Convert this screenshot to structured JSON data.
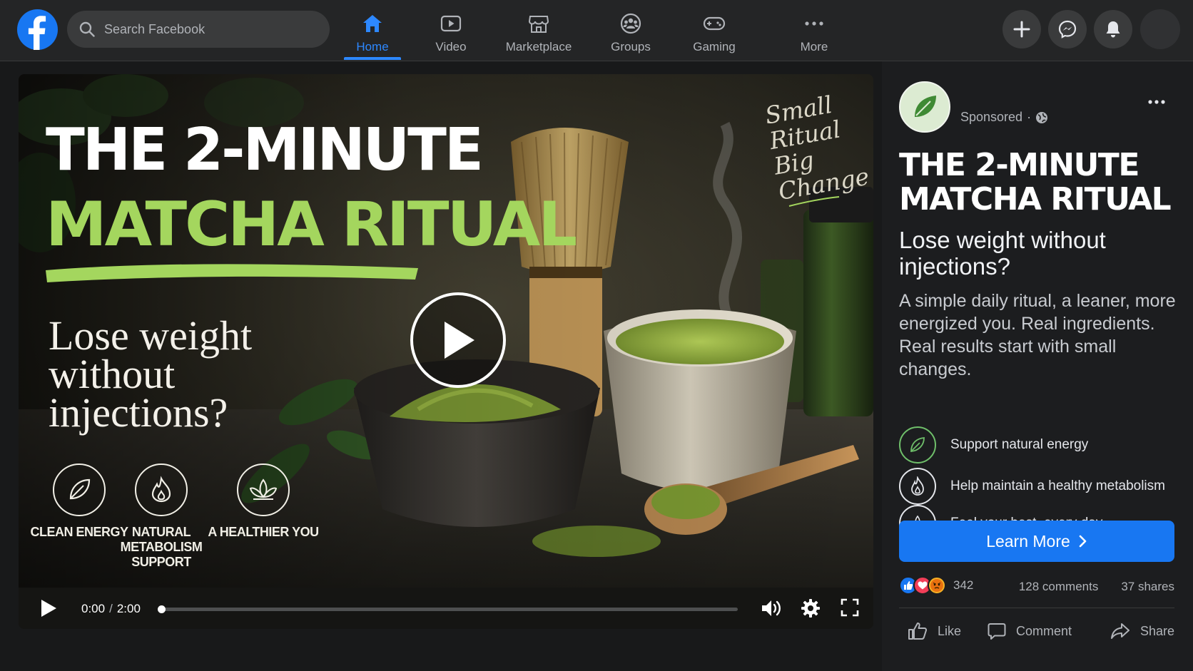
{
  "nav": {
    "search_placeholder": "Search Facebook",
    "tabs": [
      {
        "label": "Home",
        "icon": "home-icon",
        "active": true
      },
      {
        "label": "Video",
        "icon": "video-icon"
      },
      {
        "label": "Marketplace",
        "icon": "marketplace-icon"
      },
      {
        "label": "Groups",
        "icon": "groups-icon"
      },
      {
        "label": "Gaming",
        "icon": "gaming-icon"
      },
      {
        "label": "More",
        "icon": "more-dots-icon"
      }
    ],
    "right_buttons": [
      "create-plus-icon",
      "messenger-icon",
      "notifications-bell-icon",
      "profile-avatar"
    ],
    "accent": "#2d88ff"
  },
  "video": {
    "headline_line1": "THE 2-MINUTE",
    "headline_line2": "MATCHA RITUAL",
    "question": "Lose weight without injections?",
    "script_text": "Small Ritual Big Change",
    "features": [
      {
        "icon": "leaf-icon",
        "label": "CLEAN ENERGY"
      },
      {
        "icon": "flame-icon",
        "label": "NATURAL METABOLISM SUPPORT"
      },
      {
        "icon": "lotus-icon",
        "label": "A HEALTHIER YOU"
      }
    ],
    "current_time": "0:00",
    "duration": "2:00",
    "progress": 0,
    "headline_green": "#a4d65e"
  },
  "ad": {
    "sponsored_label": "Sponsored",
    "privacy_separator": "·",
    "title": "THE 2-MINUTE MATCHA RITUAL",
    "subtitle": "Lose weight without injections?",
    "body": "A simple  daily ritual, a leaner, more energized you. Real ingredients. Real results start with small changes.",
    "features": [
      {
        "icon": "leaf-icon",
        "label": "Support natural energy"
      },
      {
        "icon": "flame-icon",
        "label": "Help maintain a healthy metabolism"
      },
      {
        "icon": "lotus-icon",
        "label": "Feel your best, every day"
      }
    ],
    "cta_label": "Learn More",
    "reactions_count": "342",
    "comments": "128 comments",
    "shares": "37 shares",
    "actions": {
      "like": "Like",
      "comment": "Comment",
      "share": "Share"
    },
    "cta_color": "#1877f2"
  }
}
